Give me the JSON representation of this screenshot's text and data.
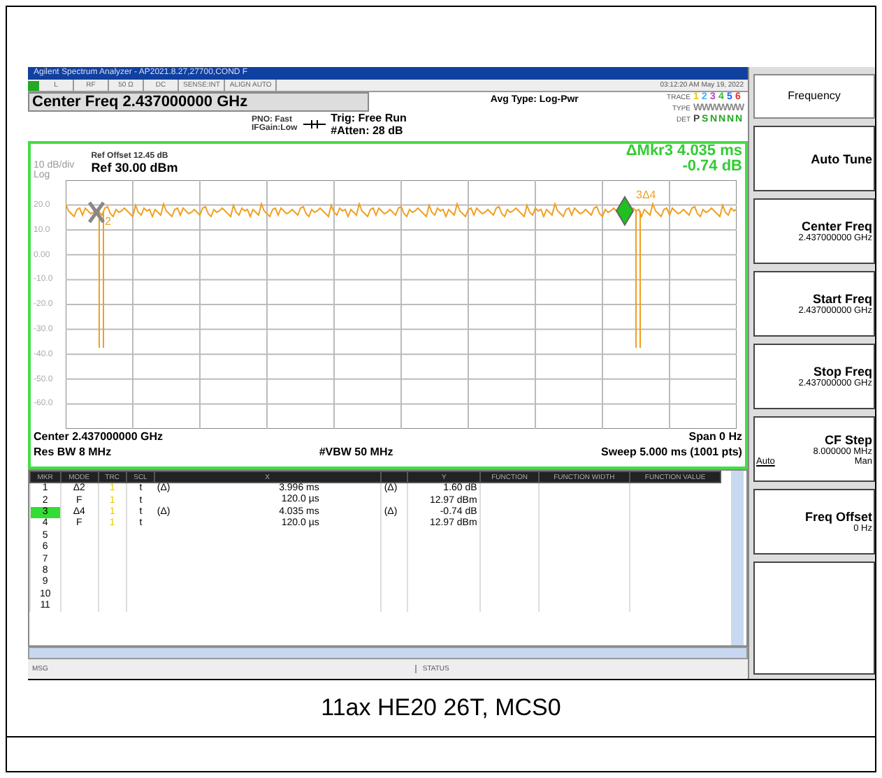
{
  "window": {
    "title": "Agilent Spectrum Analyzer - AP2021.8.27,27700,COND F"
  },
  "status_bar": {
    "items": [
      "L",
      "RF",
      "50 Ω",
      "DC",
      "SENSE:INT",
      "ALIGN AUTO"
    ],
    "datetime": "03:12:20 AM May 19, 2022"
  },
  "header": {
    "center_freq": "Center Freq 2.437000000 GHz",
    "pno": "PNO: Fast",
    "if_gain": "IFGain:Low",
    "trig": "Trig: Free Run",
    "atten": "#Atten: 28 dB",
    "avg_type": "Avg Type: Log-Pwr",
    "trace_label": "TRACE",
    "type_label": "TYPE",
    "det_label": "DET",
    "traces": [
      {
        "num": "1",
        "type": "W",
        "det": "P",
        "color": "#e8c800"
      },
      {
        "num": "2",
        "type": "W",
        "det": "S",
        "color": "#40b0ff"
      },
      {
        "num": "3",
        "type": "W",
        "det": "N",
        "color": "#c040c0"
      },
      {
        "num": "4",
        "type": "W",
        "det": "N",
        "color": "#30c030"
      },
      {
        "num": "5",
        "type": "W",
        "det": "N",
        "color": "#2060ff"
      },
      {
        "num": "6",
        "type": "W",
        "det": "N",
        "color": "#f03030"
      }
    ]
  },
  "plot": {
    "ref_offset": "Ref Offset 12.45 dB",
    "ref_level": "Ref 30.00 dBm",
    "scale": "10 dB/div",
    "scale_type": "Log",
    "marker_readout": [
      "ΔMkr3 4.035 ms",
      "-0.74 dB"
    ],
    "yticks": [
      "20.0",
      "10.0",
      "0.00",
      "-10.0",
      "-20.0",
      "-30.0",
      "-40.0",
      "-50.0",
      "-60.0"
    ],
    "markers": [
      {
        "label": "2",
        "kind": "cross",
        "selected": false
      },
      {
        "label": "3Δ4",
        "kind": "diamond",
        "selected": true
      }
    ],
    "center": "Center 2.437000000 GHz",
    "span": "Span 0 Hz",
    "rbw": "Res BW 8 MHz",
    "vbw": "#VBW 50 MHz",
    "sweep": "Sweep  5.000 ms (1001 pts)"
  },
  "marker_table": {
    "columns": [
      "MKR",
      "MODE",
      "TRC",
      "SCL",
      "X",
      "",
      "Y",
      "FUNCTION",
      "FUNCTION WIDTH",
      "FUNCTION VALUE"
    ],
    "rows": [
      {
        "mkr": "1",
        "mode": "Δ2",
        "trc": "1",
        "scl": "t",
        "x_ref": "(Δ)",
        "x": "3.996 ms",
        "y_ref": "(Δ)",
        "y": "1.60 dB",
        "selected": false
      },
      {
        "mkr": "2",
        "mode": "F",
        "trc": "1",
        "scl": "t",
        "x": "120.0 µs",
        "y": "12.97 dBm",
        "selected": false
      },
      {
        "mkr": "3",
        "mode": "Δ4",
        "trc": "1",
        "scl": "t",
        "x_ref": "(Δ)",
        "x": "4.035 ms",
        "y_ref": "(Δ)",
        "y": "-0.74 dB",
        "selected": true
      },
      {
        "mkr": "4",
        "mode": "F",
        "trc": "1",
        "scl": "t",
        "x": "120.0 µs",
        "y": "12.97 dBm",
        "selected": false
      },
      {
        "mkr": "5",
        "selected": false
      },
      {
        "mkr": "6",
        "selected": false
      },
      {
        "mkr": "7",
        "selected": false
      },
      {
        "mkr": "8",
        "selected": false
      },
      {
        "mkr": "9",
        "selected": false
      },
      {
        "mkr": "10",
        "selected": false
      },
      {
        "mkr": "11",
        "selected": false
      }
    ]
  },
  "message_bar": {
    "msg": "MSG",
    "status": "STATUS"
  },
  "softkeys": {
    "title": "Frequency",
    "keys": [
      {
        "label": "Auto Tune"
      },
      {
        "label": "Center Freq",
        "value": "2.437000000 GHz"
      },
      {
        "label": "Start Freq",
        "value": "2.437000000 GHz"
      },
      {
        "label": "Stop Freq",
        "value": "2.437000000 GHz"
      },
      {
        "label": "CF Step",
        "value": "8.000000 MHz",
        "options": [
          {
            "label": "Auto",
            "selected": true
          },
          {
            "label": "Man",
            "selected": false
          }
        ]
      },
      {
        "label": "Freq Offset",
        "value": "0 Hz"
      }
    ]
  },
  "caption": "11ax HE20 26T, MCS0"
}
